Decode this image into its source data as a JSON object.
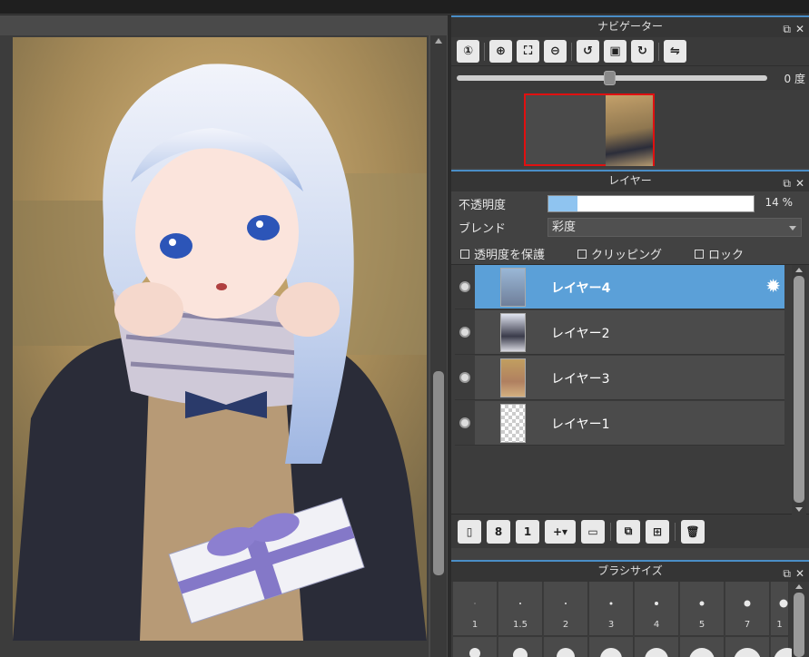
{
  "navigator": {
    "title": "ナビゲーター",
    "rotation_value": "0",
    "rotation_unit": "度",
    "tools": [
      "zoom-reset-icon",
      "zoom-in-icon",
      "fit-icon",
      "zoom-out-icon",
      "rotate-left-icon",
      "fit-window-icon",
      "rotate-right-icon",
      "flip-icon"
    ]
  },
  "layers": {
    "title": "レイヤー",
    "opacity_label": "不透明度",
    "opacity_value": "14",
    "opacity_unit": "%",
    "opacity_fraction": 0.14,
    "blend_label": "ブレンド",
    "blend_value": "彩度",
    "protect_alpha": "透明度を保護",
    "clipping": "クリッピング",
    "lock": "ロック",
    "items": [
      {
        "name": "レイヤー4",
        "selected": true
      },
      {
        "name": "レイヤー2",
        "selected": false
      },
      {
        "name": "レイヤー3",
        "selected": false
      },
      {
        "name": "レイヤー1",
        "selected": false
      }
    ]
  },
  "brush": {
    "title": "ブラシサイズ",
    "sizes": [
      "1",
      "1.5",
      "2",
      "3",
      "4",
      "5",
      "7",
      "1"
    ]
  },
  "colors": {
    "accent": "#5ba0d8",
    "panel": "#424242",
    "canvas_bg": "#4a4a4a"
  }
}
